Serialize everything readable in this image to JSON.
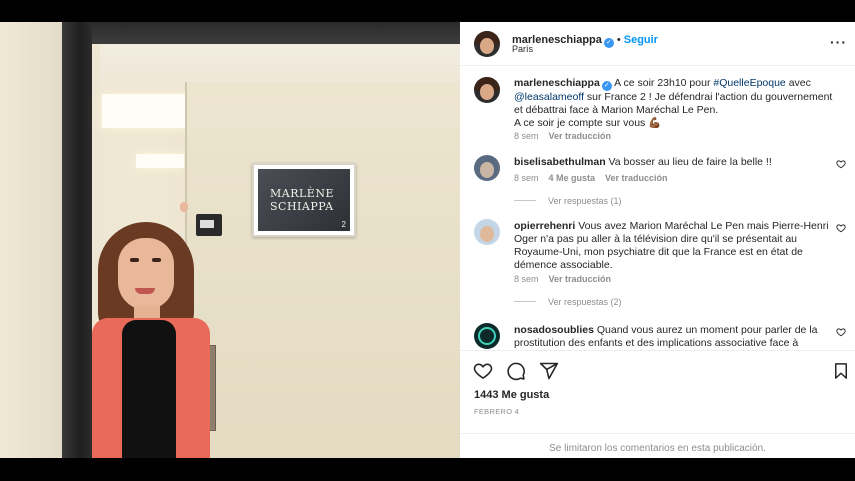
{
  "post": {
    "username": "marleneschiappa",
    "follow_label": "Seguir",
    "location": "París",
    "more_icon": "more-options-icon"
  },
  "photo": {
    "name_card_line1": "MARLÈNE",
    "name_card_line2": "SCHIAPPA",
    "name_card_number": "2"
  },
  "caption": {
    "username": "marleneschiappa",
    "text_part1": " A ce soir 23h10 pour ",
    "hashtag": "#QuelleEpoque",
    "text_part2": " avec ",
    "mention": "@leasalameoff",
    "text_part3": " sur France 2 ! Je défendrai l'action du gouvernement et débattrai face à Marion Maréchal Le Pen.",
    "text_part4": "A ce soir je compte sur vous 💪🏾",
    "time": "8 sem",
    "translate": "Ver traducción"
  },
  "comments": [
    {
      "username": "biselisabethulman",
      "text": "Va bosser au lieu de faire la belle !!",
      "time": "8 sem",
      "likes": "4 Me gusta",
      "translate": "Ver traducción",
      "replies": "Ver respuestas (1)"
    },
    {
      "username": "opierrehenri",
      "text": "Vous avez Marion Maréchal Le Pen mais Pierre-Henri Oger n'a pas pu aller à la télévision dire qu'il se présentait au Royaume-Uni, mon psychiatre dit que la France est en état de démence associable.",
      "time": "8 sem",
      "translate": "Ver traducción",
      "replies": "Ver respuestas (2)"
    },
    {
      "username": "nosadosoublies",
      "text": "Quand vous aurez un moment pour parler de la prostitution des enfants et des implications associative face à"
    }
  ],
  "footer": {
    "likes": "1443 Me gusta",
    "date": "FEBRERO 4",
    "comments_disabled": "Se limitaron los comentarios en esta publicación."
  },
  "colors": {
    "accent": "#0095f6",
    "verified": "#3897f0",
    "muted": "#8e8e8e"
  }
}
